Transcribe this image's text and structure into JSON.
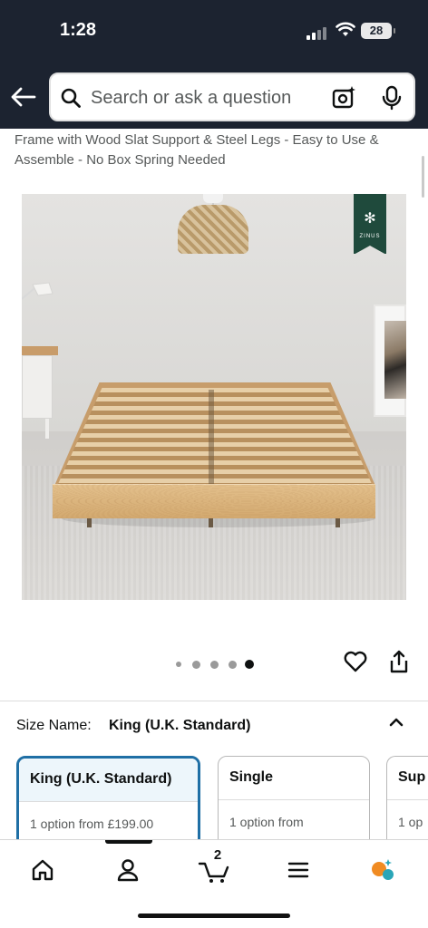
{
  "status_bar": {
    "time": "1:28",
    "battery": "28"
  },
  "header": {
    "search_placeholder": "Search or ask a question"
  },
  "product": {
    "title": "Frame with Wood Slat Support & Steel Legs - Easy to Use & Assemble - No Box Spring Needed",
    "brand_badge": "ZINUS",
    "carousel": {
      "count": 5,
      "active": 5
    }
  },
  "size": {
    "label": "Size Name:",
    "selected": "King (U.K. Standard)",
    "options": [
      {
        "name": "King (U.K. Standard)",
        "detail": "1 option from £199.00",
        "selected": true
      },
      {
        "name": "Single",
        "detail": "1 option from",
        "selected": false
      },
      {
        "name": "Sup",
        "detail": "1 op",
        "selected": false
      }
    ]
  },
  "bottom_nav": {
    "items": [
      "home-icon",
      "account-icon",
      "cart-icon",
      "menu-icon",
      "rufus-icon"
    ],
    "active": "account-icon",
    "cart_count": "2"
  },
  "colors": {
    "header_bg": "#1c2330",
    "selected_border": "#1f6fa5",
    "badge_green": "#1f4a3c",
    "rufus_orange": "#f08b22",
    "rufus_teal": "#2aa6b8"
  }
}
